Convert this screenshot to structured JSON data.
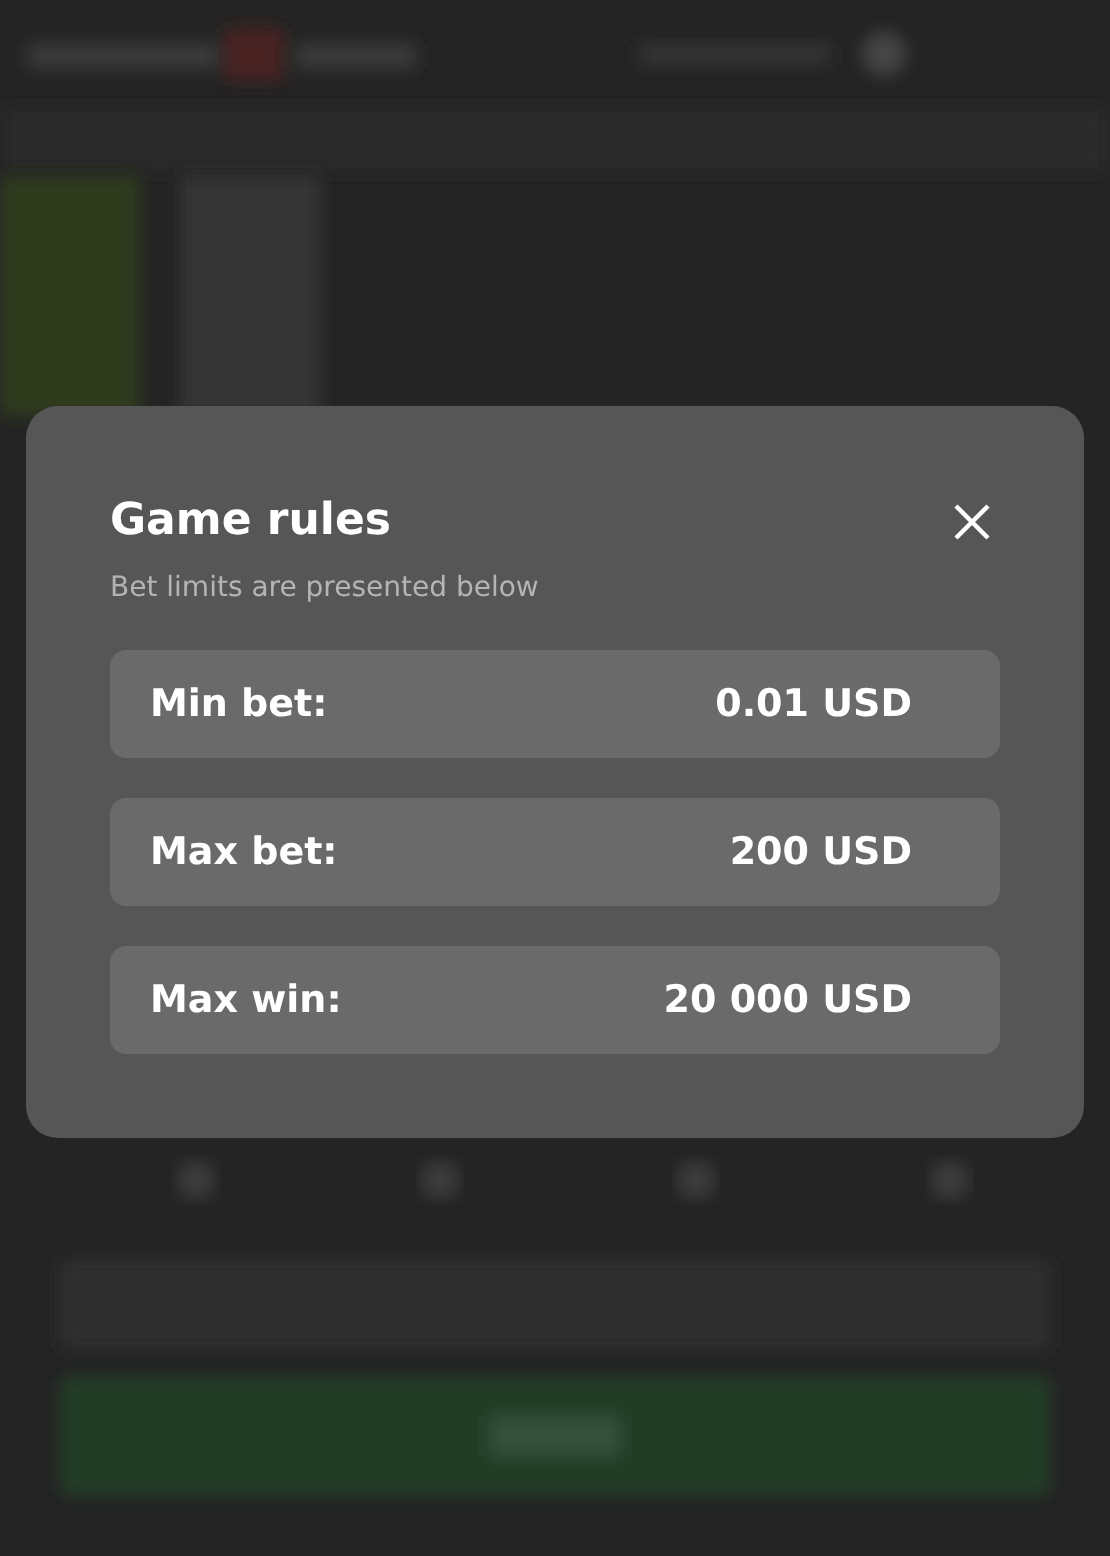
{
  "dialog": {
    "title": "Game rules",
    "subtitle": "Bet limits are presented below",
    "limits": [
      {
        "label": "Min bet:",
        "value": "0.01 USD"
      },
      {
        "label": "Max bet:",
        "value": "200 USD"
      },
      {
        "label": "Max win:",
        "value": "20 000 USD"
      }
    ]
  }
}
